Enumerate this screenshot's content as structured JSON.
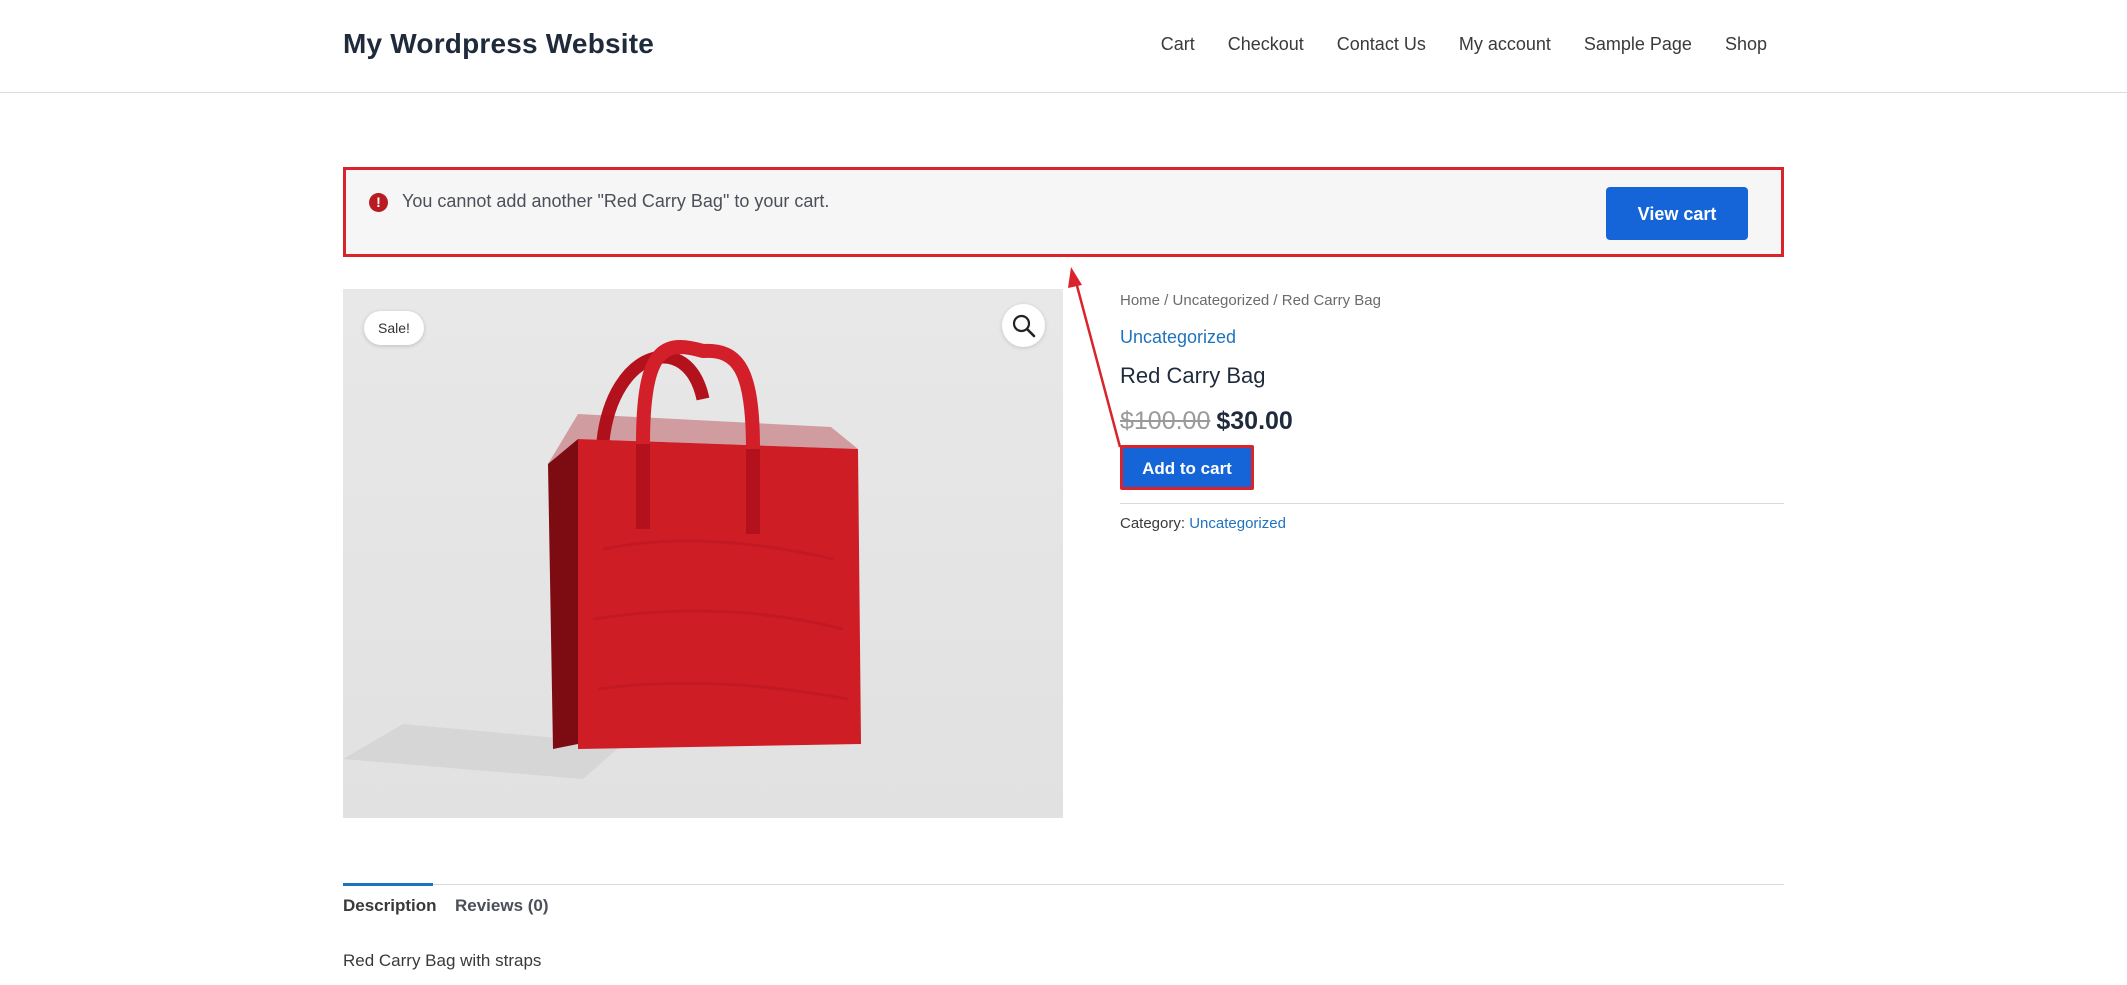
{
  "site": {
    "title": "My Wordpress Website"
  },
  "nav": {
    "items": [
      {
        "label": "Cart"
      },
      {
        "label": "Checkout"
      },
      {
        "label": "Contact Us"
      },
      {
        "label": "My account"
      },
      {
        "label": "Sample Page"
      },
      {
        "label": "Shop"
      }
    ]
  },
  "notice": {
    "icon": "error-icon",
    "icon_glyph": "!",
    "message": "You cannot add another \"Red Carry Bag\" to your cart.",
    "button_label": "View cart",
    "border_color": "#d9242c"
  },
  "product": {
    "badge": "Sale!",
    "zoom_icon": "magnifier-icon",
    "breadcrumb": [
      "Home",
      "Uncategorized",
      "Red Carry Bag"
    ],
    "breadcrumb_separator": " / ",
    "category_top": "Uncategorized",
    "title": "Red Carry Bag",
    "regular_price": "$100.00",
    "sale_price": "$30.00",
    "add_to_cart_label": "Add to cart",
    "meta_label": "Category:",
    "meta_category": "Uncategorized"
  },
  "tabs": {
    "items": [
      {
        "label": "Description"
      },
      {
        "label": "Reviews (0)"
      }
    ],
    "description": "Red Carry Bag with straps"
  },
  "colors": {
    "accent": "#1565d8",
    "link": "#1e73be",
    "annotation": "#d9242c"
  }
}
